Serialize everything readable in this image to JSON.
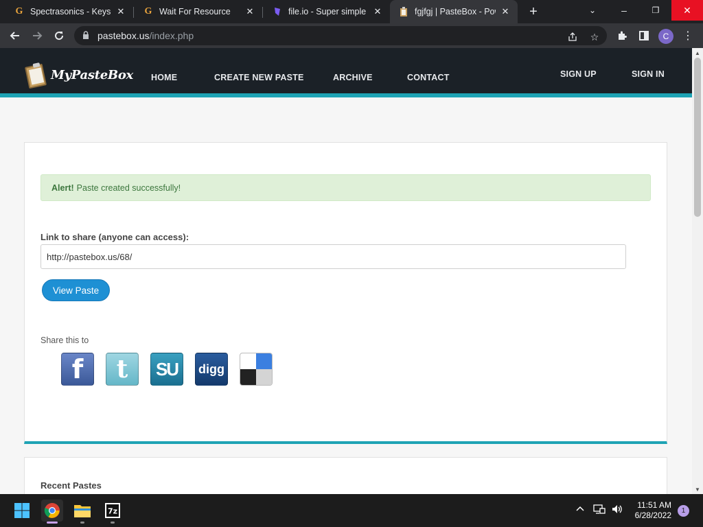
{
  "browser": {
    "tabs": [
      {
        "title": "Spectrasonics - Keyscape",
        "favicon": "G"
      },
      {
        "title": "Wait For Resource",
        "favicon": "G"
      },
      {
        "title": "file.io - Super simple file sharing",
        "favicon": "file-io-icon"
      },
      {
        "title": "fgjfgj | PasteBox - Powered",
        "favicon": "pastebox-icon",
        "active": true
      }
    ],
    "url_host": "pastebox.us",
    "url_path": "/index.php",
    "profile_initial": "C"
  },
  "site": {
    "logo_text": "MyPasteBox",
    "nav": {
      "home": "HOME",
      "create": "CREATE NEW PASTE",
      "archive": "ARCHIVE",
      "contact": "CONTACT",
      "signup": "SIGN UP",
      "signin": "SIGN IN"
    },
    "accent_color": "#1ea3b4"
  },
  "main": {
    "alert_strong": "Alert!",
    "alert_text": "Paste created successfully!",
    "share_label": "Link to share (anyone can access):",
    "share_url": "http://pastebox.us/68/",
    "view_button": "View Paste",
    "share_this": "Share this to",
    "social": [
      "facebook-icon",
      "twitter-icon",
      "stumbleupon-icon",
      "digg-icon",
      "delicious-icon"
    ]
  },
  "recent": {
    "title": "Recent Pastes"
  },
  "taskbar": {
    "time": "11:51 AM",
    "date": "6/28/2022",
    "notifications": "1"
  }
}
